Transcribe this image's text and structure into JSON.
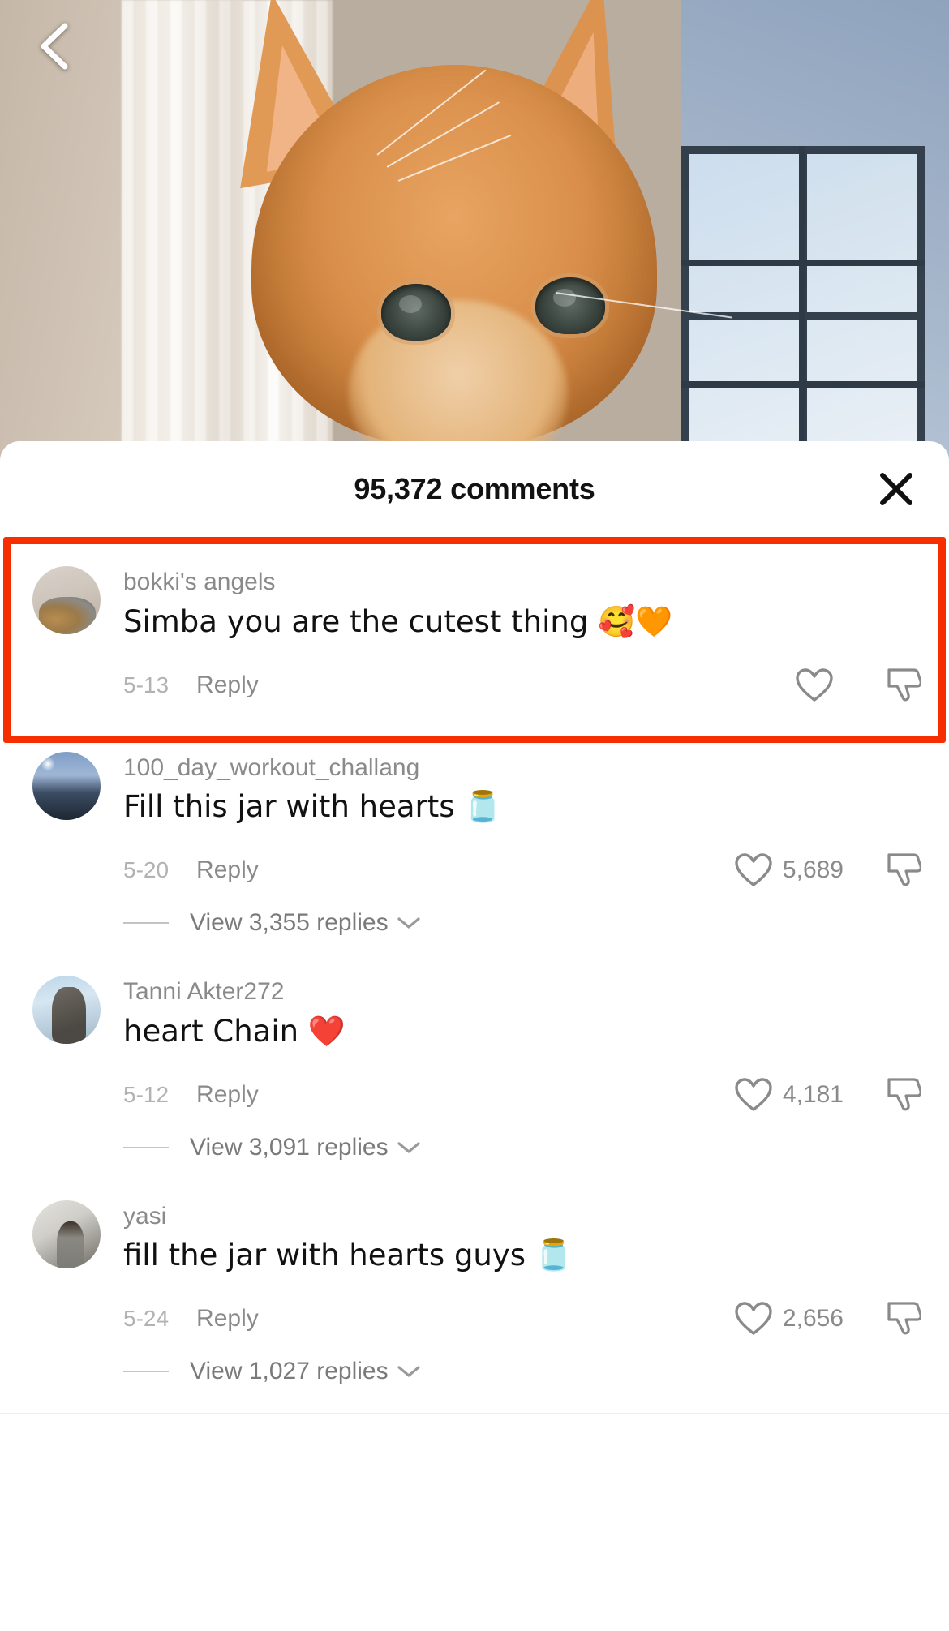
{
  "nav": {
    "back_icon": "chevron-left-icon"
  },
  "sheet": {
    "title": "95,372 comments",
    "close_icon": "close-icon"
  },
  "icons": {
    "heart": "heart-outline-icon",
    "dislike": "thumbs-down-icon",
    "chevron_down": "chevron-down-icon"
  },
  "colors": {
    "highlight": "#f62f00",
    "username": "#8a8a8a",
    "comment_text": "#111111",
    "date": "#b2b2b2",
    "sheet_bg": "#ffffff"
  },
  "comments": [
    {
      "username": "bokki's angels",
      "text": "Simba you are the cutest thing 🥰🧡",
      "date": "5-13",
      "reply_label": "Reply",
      "likes": "",
      "avatar": "av1",
      "highlighted": true,
      "replies_label": ""
    },
    {
      "username": "100_day_workout_challang",
      "text": "Fill this jar with hearts 🫙",
      "date": "5-20",
      "reply_label": "Reply",
      "likes": "5,689",
      "avatar": "av2",
      "highlighted": false,
      "replies_label": "View 3,355 replies"
    },
    {
      "username": "Tanni Akter272",
      "text": "heart Chain ❤️",
      "date": "5-12",
      "reply_label": "Reply",
      "likes": "4,181",
      "avatar": "av3",
      "highlighted": false,
      "replies_label": "View 3,091 replies"
    },
    {
      "username": "yasi",
      "text": "fill the jar with hearts guys 🫙",
      "date": "5-24",
      "reply_label": "Reply",
      "likes": "2,656",
      "avatar": "av4",
      "highlighted": false,
      "replies_label": "View 1,027 replies"
    }
  ]
}
